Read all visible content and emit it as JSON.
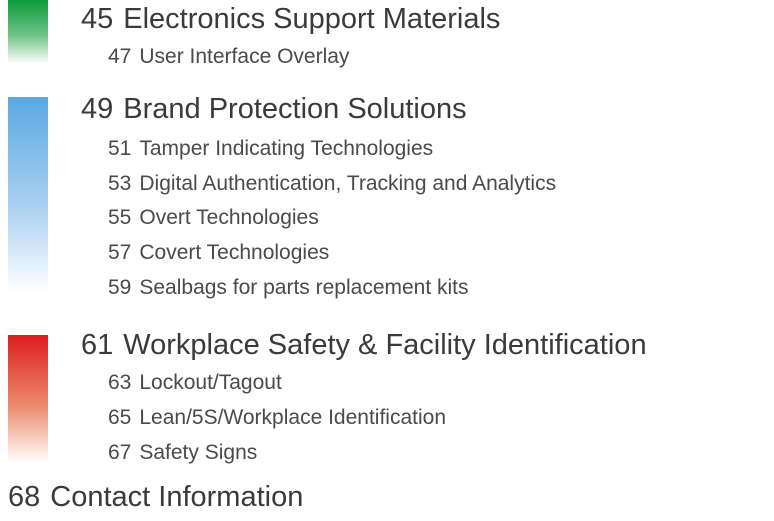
{
  "toc": [
    {
      "page": "45",
      "title": "Electronics Support Materials",
      "color": "#0c9a3c",
      "items": [
        {
          "page": "47",
          "title": "User Interface Overlay"
        }
      ]
    },
    {
      "page": "49",
      "title": "Brand Protection Solutions",
      "color": "#5aa9e2",
      "items": [
        {
          "page": "51",
          "title": "Tamper Indicating Technologies"
        },
        {
          "page": "53",
          "title": "Digital Authentication, Tracking and Analytics"
        },
        {
          "page": "55",
          "title": "Overt Technologies"
        },
        {
          "page": "57",
          "title": "Covert Technologies"
        },
        {
          "page": "59",
          "title": "Sealbags for parts replacement kits"
        }
      ]
    },
    {
      "page": "61",
      "title": "Workplace Safety & Facility Identification",
      "color": "#dc1e1e",
      "items": [
        {
          "page": "63",
          "title": "Lockout/Tagout"
        },
        {
          "page": "65",
          "title": "Lean/5S/Workplace Identification"
        },
        {
          "page": "67",
          "title": "Safety Signs"
        }
      ]
    },
    {
      "page": "68",
      "title": "Contact Information",
      "items": []
    }
  ]
}
